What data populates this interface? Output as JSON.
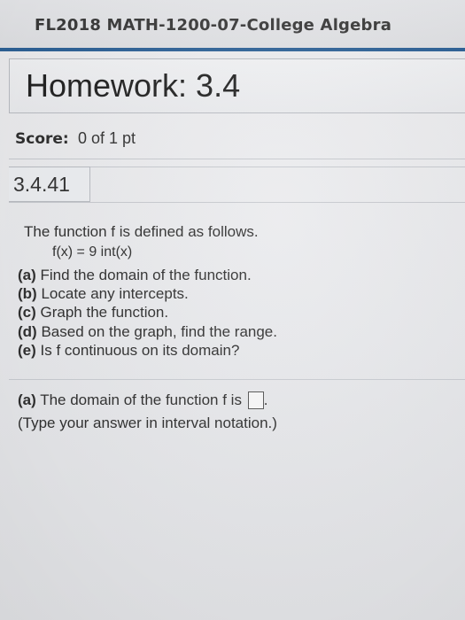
{
  "header": {
    "course_title": "FL2018 MATH-1200-07-College Algebra",
    "accent_color": "#2d6196"
  },
  "homework": {
    "title": "Homework: 3.4"
  },
  "score": {
    "label": "Score:",
    "value": "0 of 1 pt"
  },
  "question": {
    "number": "3.4.41",
    "intro": "The function f is defined as follows.",
    "formula": "f(x) = 9 int(x)",
    "parts": [
      {
        "letter": "(a)",
        "text": "Find the domain of the function."
      },
      {
        "letter": "(b)",
        "text": "Locate any intercepts."
      },
      {
        "letter": "(c)",
        "text": "Graph the function."
      },
      {
        "letter": "(d)",
        "text": "Based on the graph, find the range."
      },
      {
        "letter": "(e)",
        "text": "Is f continuous on its domain?"
      }
    ]
  },
  "answer": {
    "part_letter": "(a)",
    "prompt": "The domain of the function f is",
    "after_box": ".",
    "hint": "(Type your answer in interval notation.)",
    "value": ""
  }
}
